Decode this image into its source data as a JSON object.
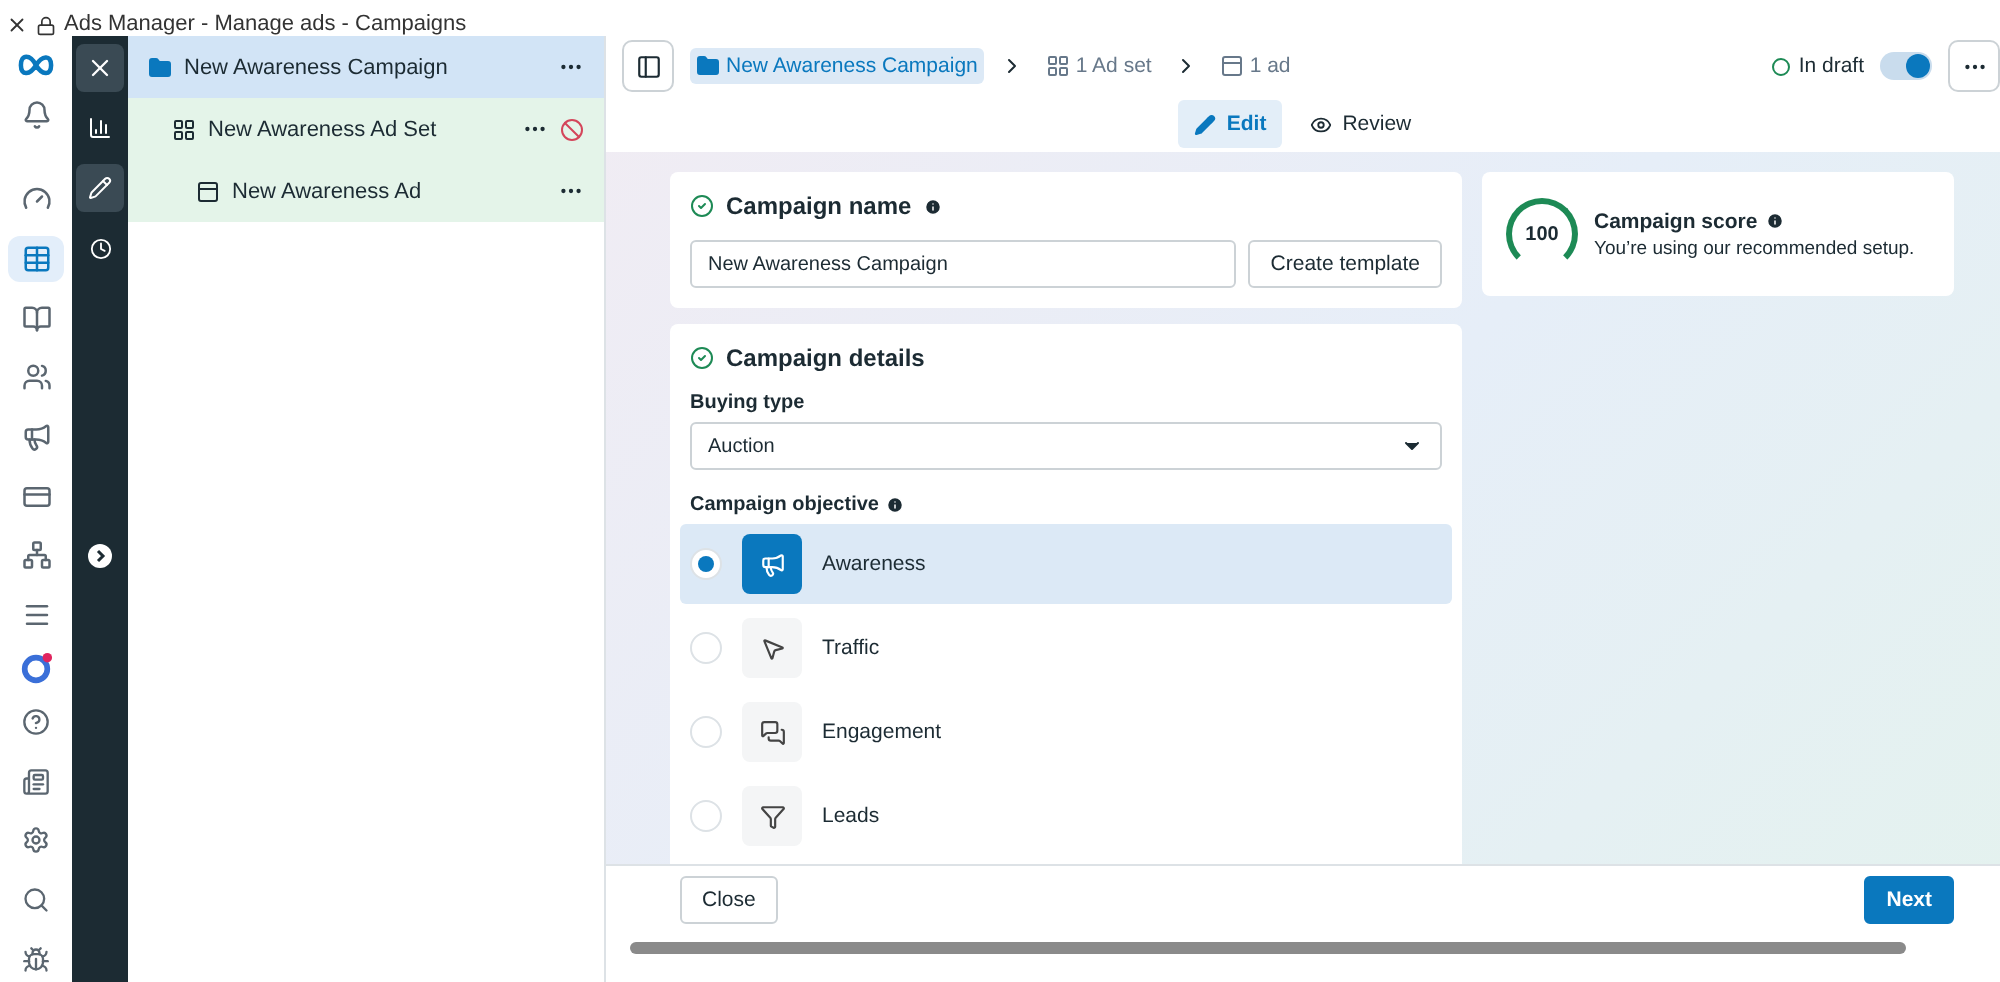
{
  "window": {
    "title": "Ads Manager - Manage ads - Campaigns"
  },
  "tree": [
    {
      "kind": "campaign",
      "label": "New Awareness Campaign",
      "selected": true,
      "error": false,
      "children": [
        {
          "kind": "adset",
          "label": "New Awareness Ad Set",
          "selected": false,
          "error": true,
          "children": [
            {
              "kind": "ad",
              "label": "New Awareness Ad",
              "selected": false,
              "error": false
            }
          ]
        }
      ]
    }
  ],
  "breadcrumb": [
    {
      "kind": "campaign",
      "label": "New Awareness Campaign",
      "selected": true
    },
    {
      "kind": "adset",
      "label": "1 Ad set",
      "selected": false
    },
    {
      "kind": "ad",
      "label": "1 ad",
      "selected": false
    }
  ],
  "status": {
    "label": "In draft",
    "on": true
  },
  "tabs": [
    {
      "kind": "edit",
      "label": "Edit",
      "selected": true
    },
    {
      "kind": "review",
      "label": "Review",
      "selected": false
    }
  ],
  "campaign_name": {
    "title": "Campaign name",
    "value": "New Awareness Campaign",
    "button": "Create template"
  },
  "campaign_details": {
    "title": "Campaign details",
    "buying_type_label": "Buying type",
    "buying_type": "Auction",
    "objective_label": "Campaign objective",
    "objectives": [
      {
        "kind": "awareness",
        "label": "Awareness",
        "selected": true
      },
      {
        "kind": "traffic",
        "label": "Traffic",
        "selected": false
      },
      {
        "kind": "engagement",
        "label": "Engagement",
        "selected": false
      },
      {
        "kind": "leads",
        "label": "Leads",
        "selected": false
      }
    ]
  },
  "score": {
    "value": "100",
    "title": "Campaign score",
    "text": "You’re using our recommended setup."
  },
  "footer": {
    "close": "Close",
    "next": "Next"
  }
}
